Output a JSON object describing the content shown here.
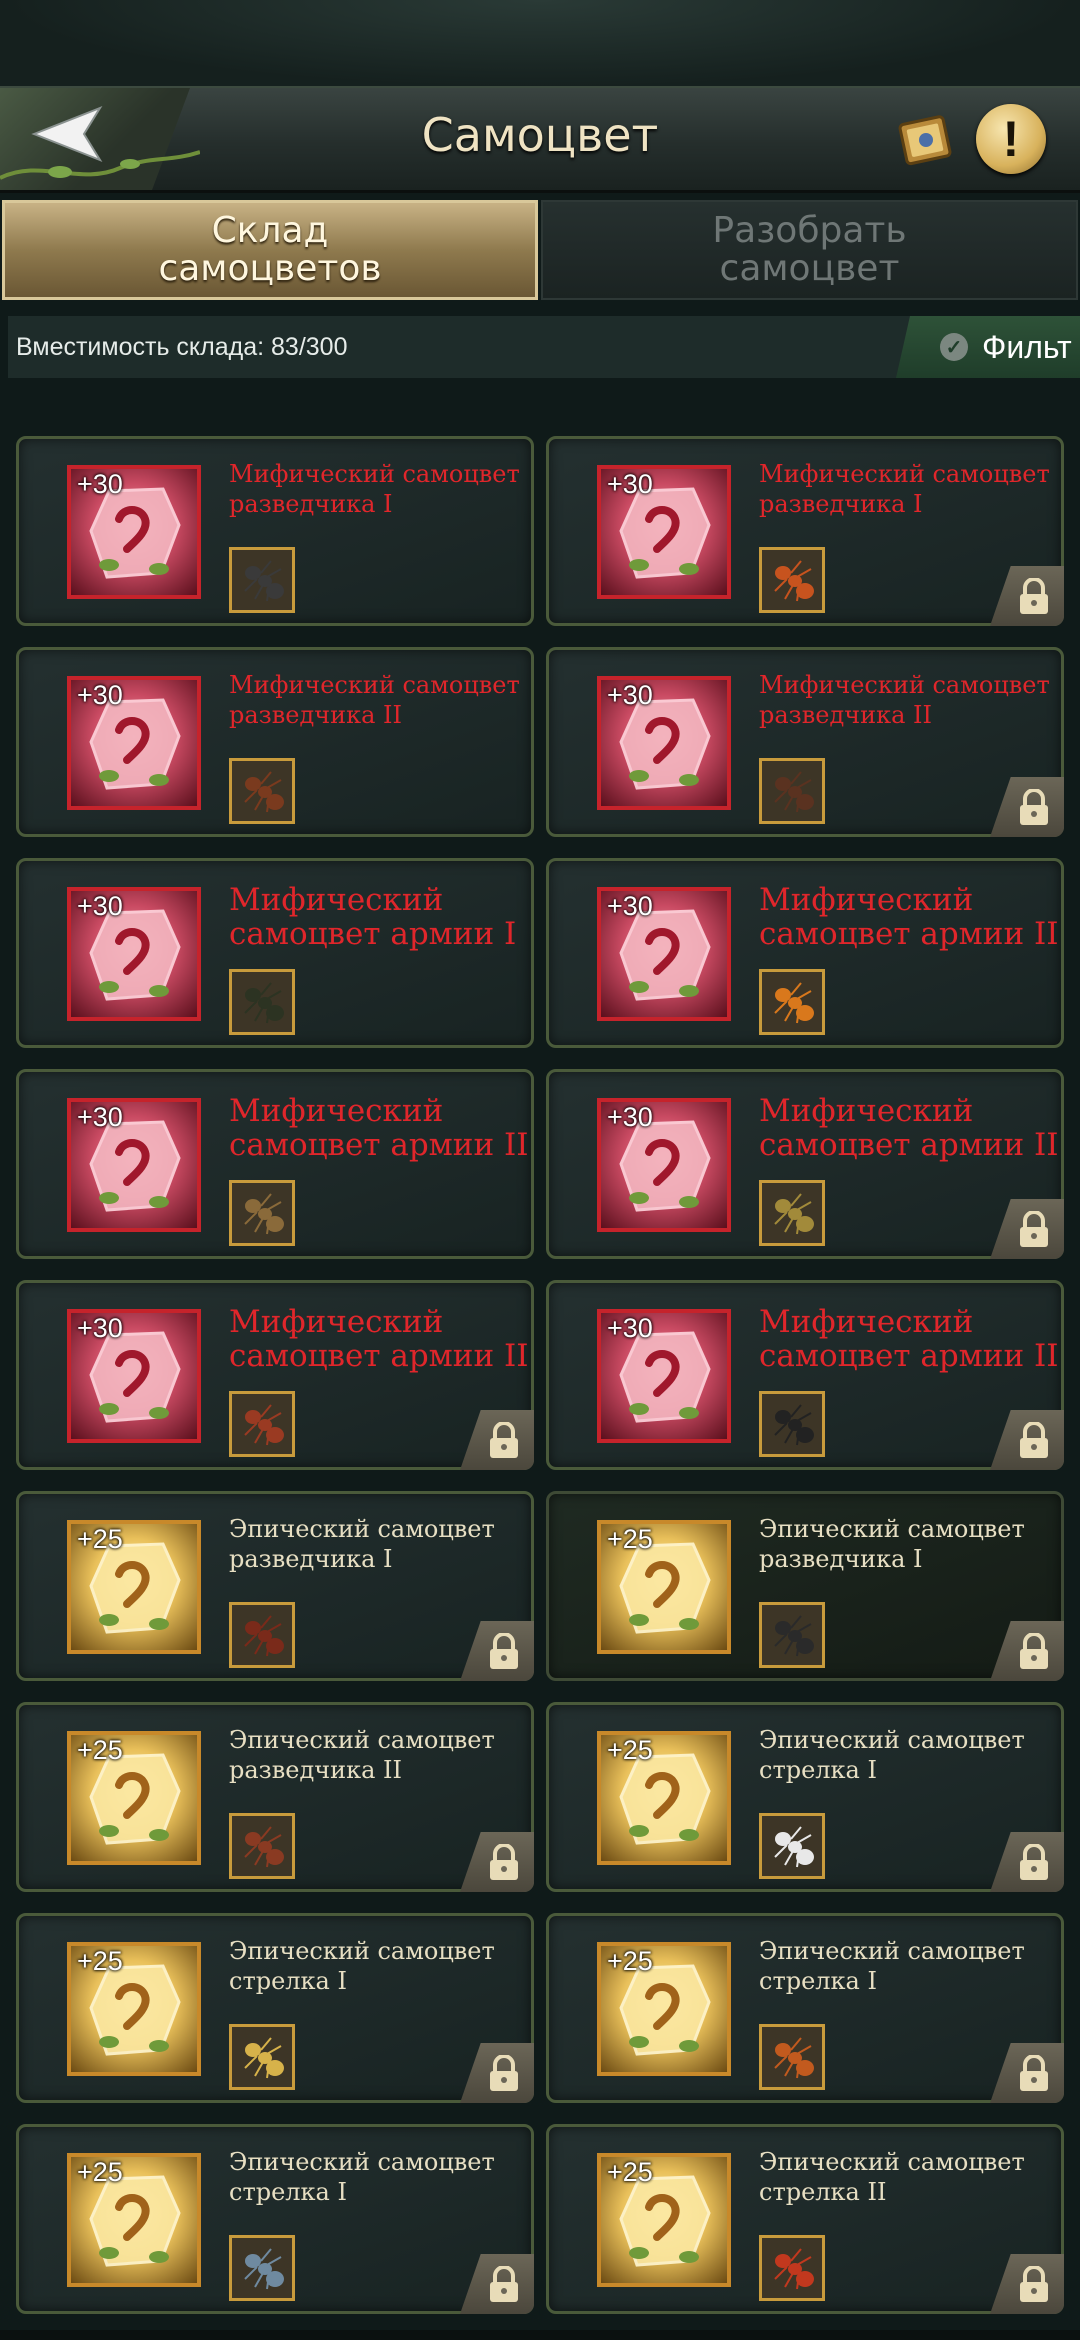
{
  "header": {
    "title": "Самоцвет"
  },
  "tabs": [
    {
      "label": "Склад\nсамоцветов",
      "active": true
    },
    {
      "label": "Разобрать\nсамоцвет",
      "active": false
    }
  ],
  "capacity": {
    "text": "Вместимость склада: 83/300"
  },
  "filter": {
    "label": "Фильт"
  },
  "colors": {
    "mythic_text": "#e0262b",
    "epic_text": "#e7dfc3",
    "mythic_frame": "#c6232b",
    "epic_frame": "#c8892a"
  },
  "gems": [
    {
      "level": "+30",
      "name": "Мифический самоцвет разведчика I",
      "rarity": "mythic",
      "size": "small",
      "locked": false,
      "unit_icon": "ant-icon",
      "unit_color": "#3a3a3a"
    },
    {
      "level": "+30",
      "name": "Мифический самоцвет разведчика I",
      "rarity": "mythic",
      "size": "small",
      "locked": true,
      "unit_icon": "ant-icon",
      "unit_color": "#c7531e"
    },
    {
      "level": "+30",
      "name": "Мифический самоцвет разведчика II",
      "rarity": "mythic",
      "size": "small",
      "locked": false,
      "unit_icon": "ant-icon",
      "unit_color": "#7a3a1e"
    },
    {
      "level": "+30",
      "name": "Мифический самоцвет разведчика II",
      "rarity": "mythic",
      "size": "small",
      "locked": true,
      "unit_icon": "ant-icon",
      "unit_color": "#5a3220"
    },
    {
      "level": "+30",
      "name": "Мифический самоцвет армии I",
      "rarity": "mythic",
      "size": "big",
      "locked": false,
      "unit_icon": "beetle-icon",
      "unit_color": "#2c3322"
    },
    {
      "level": "+30",
      "name": "Мифический самоцвет армии II",
      "rarity": "mythic",
      "size": "big",
      "locked": false,
      "unit_icon": "ant-icon",
      "unit_color": "#d9781c"
    },
    {
      "level": "+30",
      "name": "Мифический самоцвет армии II",
      "rarity": "mythic",
      "size": "big",
      "locked": false,
      "unit_icon": "warrior-ant-icon",
      "unit_color": "#8a6a3a"
    },
    {
      "level": "+30",
      "name": "Мифический самоцвет армии II",
      "rarity": "mythic",
      "size": "big",
      "locked": true,
      "unit_icon": "hornet-icon",
      "unit_color": "#a28a3a"
    },
    {
      "level": "+30",
      "name": "Мифический самоцвет армии II",
      "rarity": "mythic",
      "size": "big",
      "locked": true,
      "unit_icon": "beetle-icon",
      "unit_color": "#9a3a22"
    },
    {
      "level": "+30",
      "name": "Мифический самоцвет армии II",
      "rarity": "mythic",
      "size": "big",
      "locked": true,
      "unit_icon": "ant-icon",
      "unit_color": "#222222"
    },
    {
      "level": "+25",
      "name": "Эпический самоцвет разведчика I",
      "rarity": "epic",
      "size": "small",
      "locked": true,
      "unit_icon": "ant-icon",
      "unit_color": "#7a2a1a"
    },
    {
      "level": "+25",
      "name": "Эпический самоцвет разведчика I",
      "rarity": "epic",
      "size": "small",
      "locked": true,
      "unit_icon": "ant-icon",
      "unit_color": "#2a2a2a",
      "selected": true
    },
    {
      "level": "+25",
      "name": "Эпический самоцвет разведчика II",
      "rarity": "epic",
      "size": "small",
      "locked": true,
      "unit_icon": "ant-icon",
      "unit_color": "#8a3a22"
    },
    {
      "level": "+25",
      "name": "Эпический самоцвет стрелка I",
      "rarity": "epic",
      "size": "small",
      "locked": true,
      "unit_icon": "white-ant-icon",
      "unit_color": "#e8e8e8"
    },
    {
      "level": "+25",
      "name": "Эпический самоцвет стрелка I",
      "rarity": "epic",
      "size": "small",
      "locked": true,
      "unit_icon": "ant-icon",
      "unit_color": "#d7b24a"
    },
    {
      "level": "+25",
      "name": "Эпический самоцвет стрелка I",
      "rarity": "epic",
      "size": "small",
      "locked": true,
      "unit_icon": "ant-icon",
      "unit_color": "#c25a1e"
    },
    {
      "level": "+25",
      "name": "Эпический самоцвет стрелка I",
      "rarity": "epic",
      "size": "small",
      "locked": true,
      "unit_icon": "ant-icon",
      "unit_color": "#6f8aa0"
    },
    {
      "level": "+25",
      "name": "Эпический самоцвет стрелка II",
      "rarity": "epic",
      "size": "small",
      "locked": true,
      "unit_icon": "ant-icon",
      "unit_color": "#c2381e"
    }
  ]
}
